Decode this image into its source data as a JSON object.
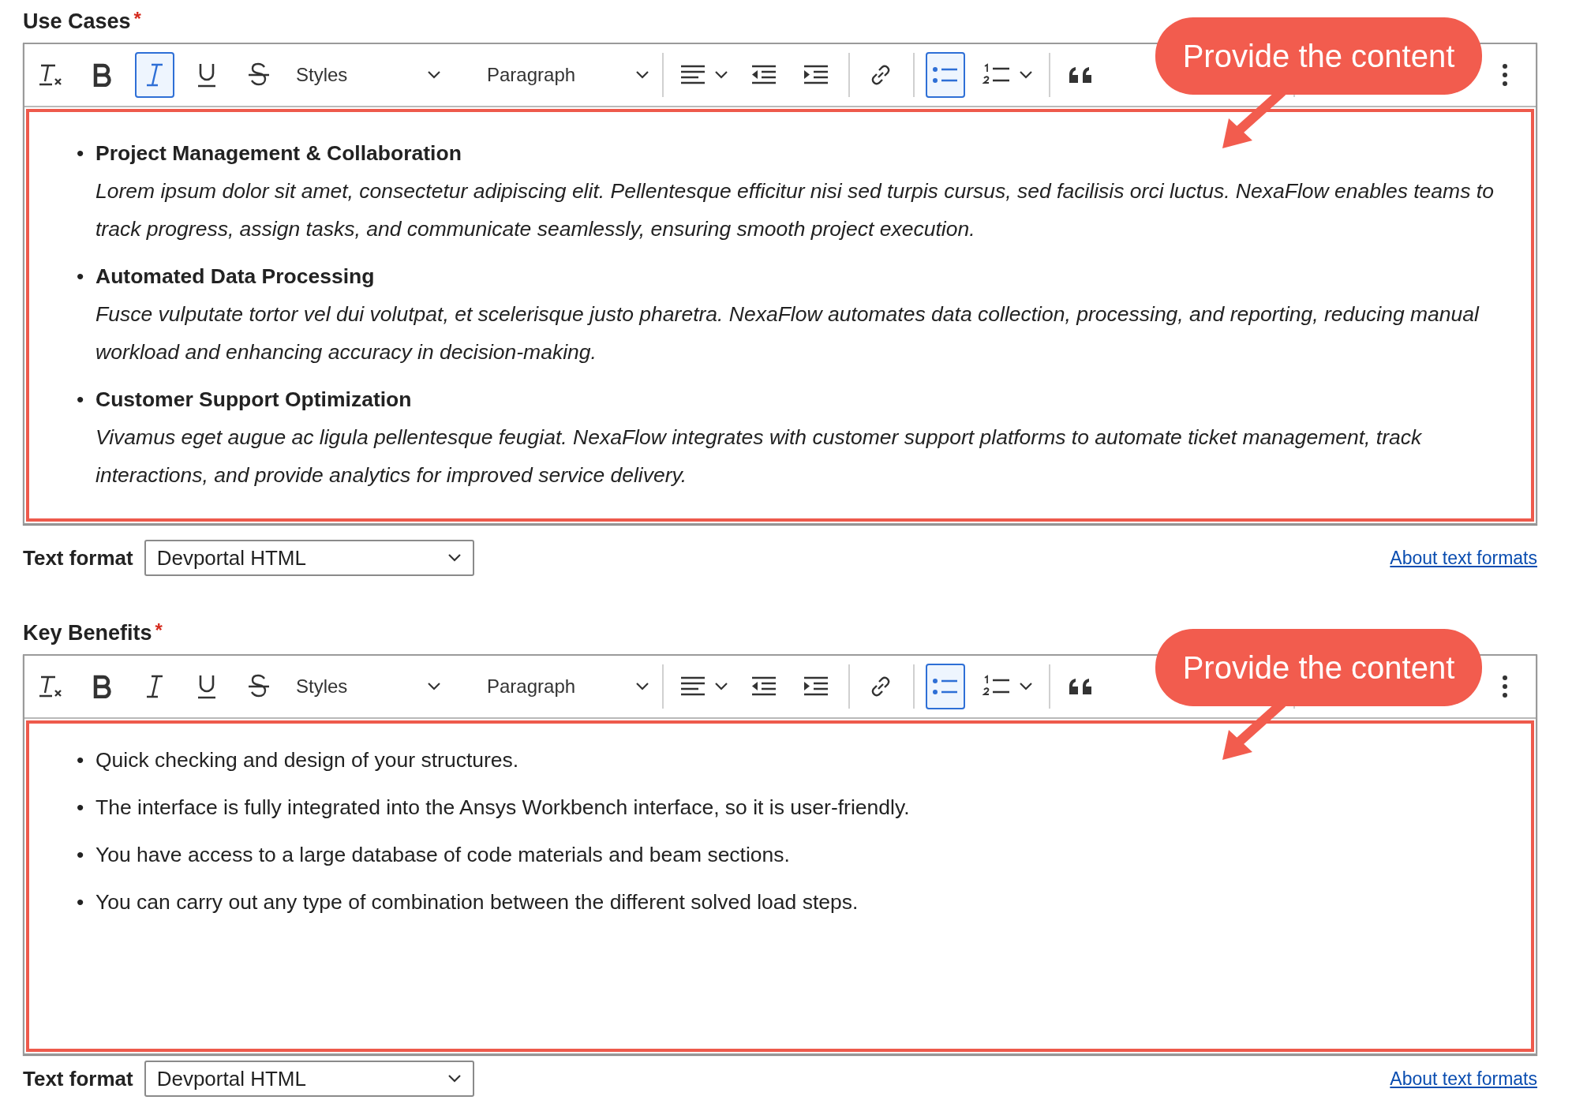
{
  "fields": [
    {
      "label": "Use Cases",
      "required_mark": "*",
      "toolbar": [
        {
          "kind": "clear-format",
          "selected": false
        },
        {
          "kind": "bold",
          "selected": false
        },
        {
          "kind": "italic",
          "selected": true
        },
        {
          "kind": "underline",
          "selected": false
        },
        {
          "kind": "strikethrough",
          "selected": false
        },
        {
          "kind": "dropdown",
          "label": "Styles",
          "selected": false
        },
        {
          "kind": "dropdown",
          "label": "Paragraph",
          "selected": false
        },
        {
          "kind": "align",
          "selected": false
        },
        {
          "kind": "outdent",
          "selected": false
        },
        {
          "kind": "indent",
          "selected": false
        },
        {
          "kind": "link",
          "selected": false
        },
        {
          "kind": "bulleted-list",
          "selected": true
        },
        {
          "kind": "numbered-list",
          "selected": false
        },
        {
          "kind": "blockquote",
          "selected": false
        },
        {
          "kind": "more",
          "selected": false
        }
      ],
      "callout": {
        "text": "Provide the content"
      },
      "highlighted": true,
      "items": [
        {
          "kind": "titled",
          "marker": "•",
          "title": "Project Management & Collaboration",
          "text": "Lorem ipsum dolor sit amet, consectetur adipiscing elit. Pellentesque efficitur nisi sed turpis cursus, sed facilisis orci luctus. NexaFlow enables teams to track progress, assign tasks, and communicate seamlessly, ensuring smooth project execution."
        },
        {
          "kind": "titled",
          "marker": "•",
          "title": "Automated Data Processing",
          "text": "Fusce vulputate tortor vel dui volutpat, et scelerisque justo pharetra. NexaFlow automates data collection, processing, and reporting, reducing manual workload and enhancing accuracy in decision-making."
        },
        {
          "kind": "titled",
          "marker": "•",
          "title": "Customer Support Optimization",
          "text": "Vivamus eget augue ac ligula pellentesque feugiat. NexaFlow integrates with customer support platforms to automate ticket management, track interactions, and provide analytics for improved service delivery."
        }
      ],
      "format_label": "Text format",
      "format_value": "Devportal HTML",
      "help_link": "About text formats"
    },
    {
      "label": "Key Benefits",
      "required_mark": "*",
      "toolbar": [
        {
          "kind": "clear-format",
          "selected": false
        },
        {
          "kind": "bold",
          "selected": false
        },
        {
          "kind": "italic",
          "selected": false
        },
        {
          "kind": "underline",
          "selected": false
        },
        {
          "kind": "strikethrough",
          "selected": false
        },
        {
          "kind": "dropdown",
          "label": "Styles",
          "selected": false
        },
        {
          "kind": "dropdown",
          "label": "Paragraph",
          "selected": false
        },
        {
          "kind": "align",
          "selected": false
        },
        {
          "kind": "outdent",
          "selected": false
        },
        {
          "kind": "indent",
          "selected": false
        },
        {
          "kind": "link",
          "selected": false
        },
        {
          "kind": "bulleted-list",
          "selected": true
        },
        {
          "kind": "numbered-list",
          "selected": false
        },
        {
          "kind": "blockquote",
          "selected": false
        },
        {
          "kind": "more",
          "selected": false
        }
      ],
      "callout": {
        "text": "Provide the content"
      },
      "highlighted": true,
      "items": [
        {
          "kind": "plain",
          "marker": "•",
          "text": "Quick checking and design of your structures."
        },
        {
          "kind": "plain",
          "marker": "•",
          "text": "The interface is fully integrated into the Ansys Workbench interface, so it is user-friendly."
        },
        {
          "kind": "plain",
          "marker": "•",
          "text": "You have access to a large database of code materials and beam sections."
        },
        {
          "kind": "plain",
          "marker": "•",
          "text": "You can carry out any type of combination between the different solved load steps."
        }
      ],
      "format_label": "Text format",
      "format_value": "Devportal HTML",
      "help_link": "About text formats"
    }
  ]
}
